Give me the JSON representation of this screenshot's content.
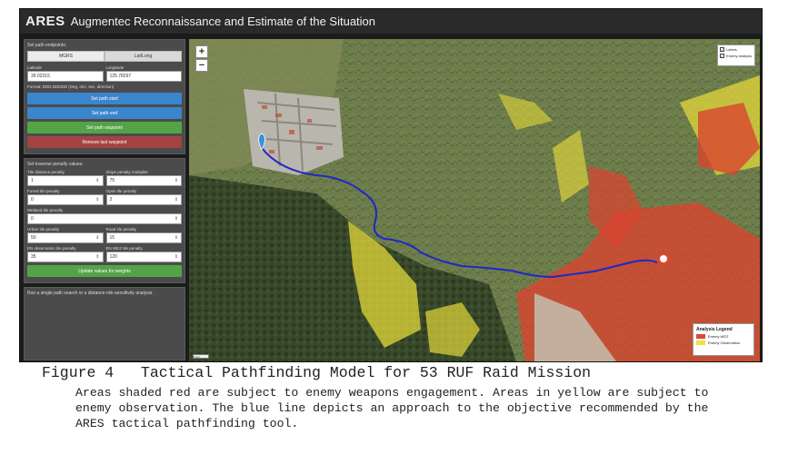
{
  "app": {
    "brand": "ARES",
    "subtitle": "Augmentec Reconnaissance and Estimate of the Situation"
  },
  "endpoint_panel": {
    "title": "Set path endpoints:",
    "modes": [
      "MGRS",
      "Lat/Long"
    ],
    "active_mode": 1,
    "latitude_label": "Latitude",
    "latitude_value": "39.02315",
    "longitude_label": "Longitude",
    "longitude_value": "125.78297",
    "format_note": "Format: DDD.DDDDD (Deg, min, sec, direction)",
    "buttons": {
      "start": "Set path start",
      "end": "Set path end",
      "set_waypoint": "Set path waypoint",
      "remove_waypoint": "Remove last waypoint"
    }
  },
  "penalty_panel": {
    "title": "Set traverse penalty values:",
    "fields": {
      "tile_distance": {
        "label": "Tile distance penalty",
        "value": "1"
      },
      "slope_multiplier": {
        "label": "Slope penalty multiplier",
        "value": "75"
      },
      "forest": {
        "label": "Forest tile penalty",
        "value": "0"
      },
      "open": {
        "label": "Open tile penalty",
        "value": "2"
      },
      "wetland": {
        "label": "Wetland tile penalty",
        "value": "0"
      },
      "urban": {
        "label": "Urban tile penalty",
        "value": "50"
      },
      "road": {
        "label": "Road tile penalty",
        "value": "15"
      },
      "en_observation": {
        "label": "EN observation tile penalty",
        "value": "35"
      },
      "en_weapons": {
        "label": "EN WEZ tile penalty",
        "value": "120"
      }
    },
    "update_button": "Update values for weights"
  },
  "hint_panel": {
    "text": "Run a single path search or a distance-risk sensitivity analysis."
  },
  "map": {
    "zoom_in": "+",
    "zoom_out": "−",
    "layers": [
      {
        "label": "Labels",
        "checked": true
      },
      {
        "label": "Enemy analysis",
        "checked": true
      }
    ],
    "legend": {
      "title": "Analysis Legend",
      "items": [
        {
          "label": "Enemy WEZ",
          "color": "#e2452f"
        },
        {
          "label": "Enemy Observation",
          "color": "#f2e23a"
        }
      ]
    },
    "scale_label": "1 km",
    "path_color": "#1f27c8",
    "wez_color": "#e2452f",
    "observation_color": "#f2e23a",
    "marker_color": "#3a8de0"
  },
  "caption": {
    "figure_title": "Figure 4   Tactical Pathfinding Model for 53 RUF Raid Mission",
    "body": "Areas shaded red are subject to enemy weapons engagement. Areas in yellow are subject to enemy observation. The blue line depicts an approach to the objective recommended by the ARES tactical pathfinding tool."
  }
}
